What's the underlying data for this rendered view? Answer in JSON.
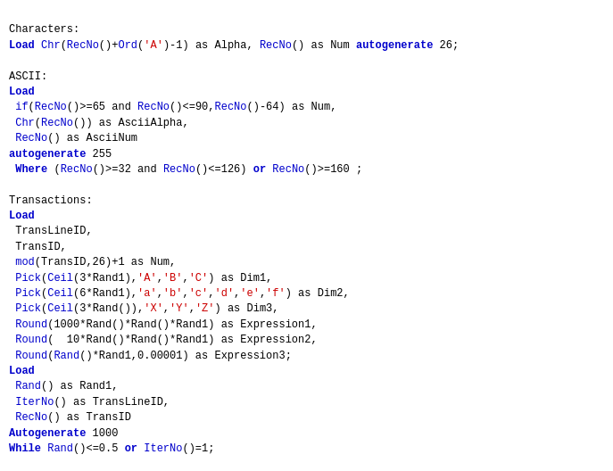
{
  "code": {
    "lines": []
  },
  "colors": {
    "keyword": "#0000cc",
    "comment": "#006600",
    "string": "#cc0000",
    "plain": "#000000",
    "link": "#0000ff",
    "redact": "#cc0000"
  }
}
